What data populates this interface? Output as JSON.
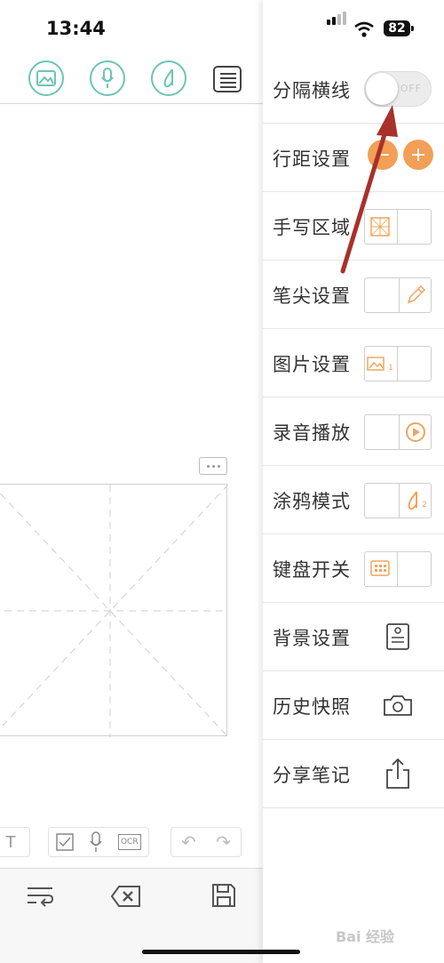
{
  "status": {
    "time": "13:44",
    "battery": "82"
  },
  "menu": {
    "items": [
      {
        "label": "分隔横线",
        "switch_text": "OFF"
      },
      {
        "label": "行距设置",
        "minus": "−",
        "plus": "+"
      },
      {
        "label": "手写区域"
      },
      {
        "label": "笔尖设置"
      },
      {
        "label": "图片设置",
        "sub": "1"
      },
      {
        "label": "录音播放"
      },
      {
        "label": "涂鸦模式",
        "sub": "2"
      },
      {
        "label": "键盘开关"
      },
      {
        "label": "背景设置"
      },
      {
        "label": "历史快照"
      },
      {
        "label": "分享笔记"
      }
    ]
  },
  "toolbar": {
    "ocr_label": "OCR",
    "text_tool": "T"
  },
  "colors": {
    "accent": "#6cc5b6",
    "orange": "#f29f57",
    "arrow": "#a8312b"
  },
  "watermark": "Bai 经验"
}
